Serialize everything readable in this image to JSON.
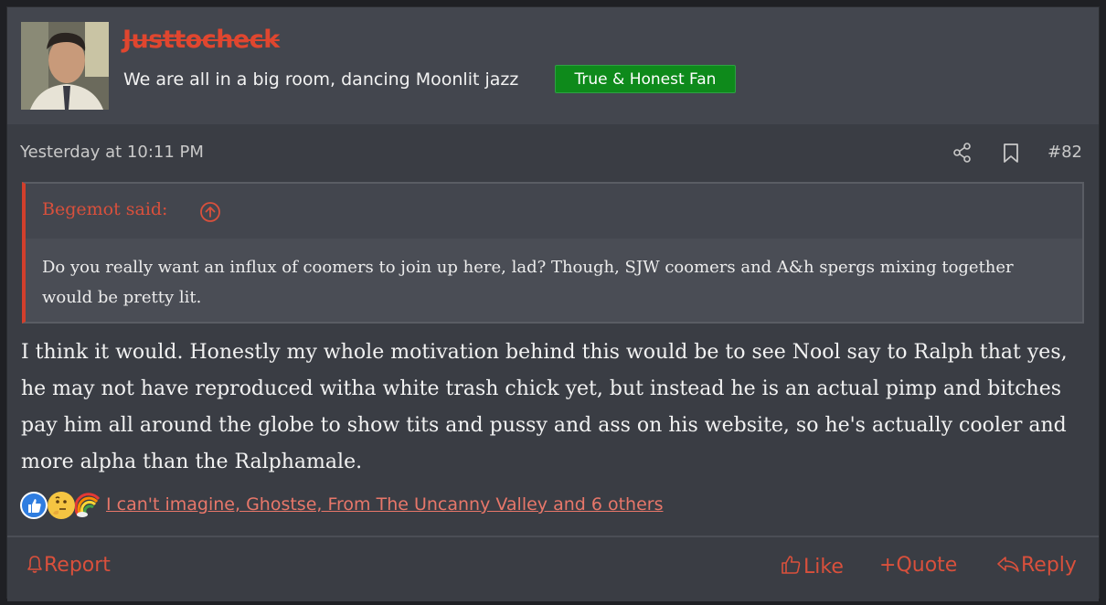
{
  "header": {
    "username": "Justtocheck",
    "user_title": "We are all in a big room, dancing Moonlit jazz",
    "badge": "True & Honest Fan"
  },
  "meta": {
    "date": "Yesterday at 10:11 PM",
    "post_number": "#82"
  },
  "quote": {
    "author": "Begemot said:",
    "body": "Do you really want an influx of coomers to join up here, lad? Though, SJW coomers and A&h spergs mixing together would be pretty lit."
  },
  "message": "I think it would. Honestly my whole motivation behind this would be to see Nool say to Ralph that yes, he may not have reproduced witha white trash chick yet, but instead he is an actual pimp and bitches pay him all around the globe to show tits and pussy and ass on his website, so he's actually cooler and more alpha than the Ralphamale.",
  "reactions": {
    "icons": [
      "like-icon",
      "thinking-icon",
      "rainbow-icon"
    ],
    "list_text": "I can't imagine, Ghostse, From The Uncanny Valley and 6 others"
  },
  "actions": {
    "report": "Report",
    "like": "Like",
    "quote": "Quote",
    "reply": "Reply"
  },
  "colors": {
    "accent": "#d9503c",
    "badge": "#0e8a1b",
    "background": "#3a3d44"
  }
}
